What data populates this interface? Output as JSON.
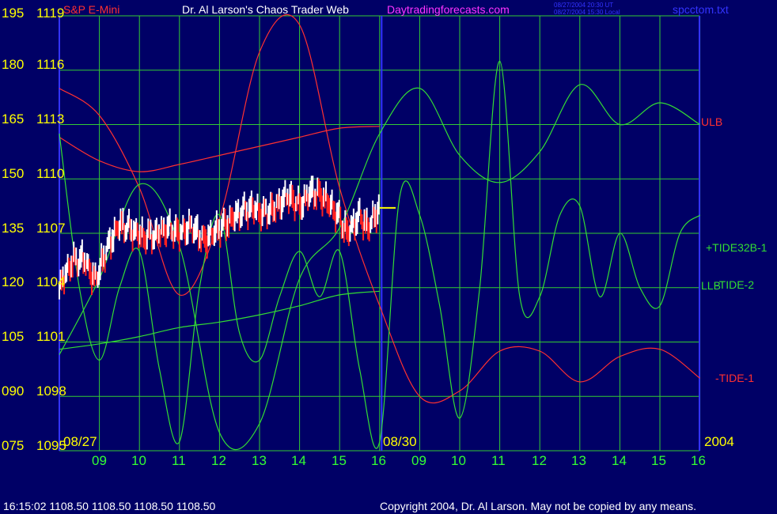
{
  "header": {
    "left": "S&P E-Mini",
    "title": "Dr. Al Larson's Chaos Trader Web",
    "site": "Daytradingforecasts.com",
    "stamp_ut": "08/27/2004 20:30 UT",
    "stamp_local": "08/27/2004 15:30 Local",
    "file": "spcctom.txt"
  },
  "footer": {
    "quote": "16:15:02  1108.50 1108.50 1108.50 1108.50",
    "copyright": "Copyright 2004, Dr. Al Larson. May not be copied by any means."
  },
  "colors": {
    "background": "#000066",
    "grid": "#33cc33",
    "price": "#ffffff",
    "down_bar": "#ff2020",
    "red_series": "#ff3030",
    "green_series": "#33dd33",
    "axis_text": "#ffff00",
    "divider": "#3333ff"
  },
  "chart_data": {
    "type": "line",
    "title": "S&P E-Mini",
    "x_ticks": [
      "09",
      "10",
      "11",
      "12",
      "13",
      "14",
      "15",
      "16",
      "09",
      "10",
      "11",
      "12",
      "13",
      "14",
      "15",
      "16"
    ],
    "date_labels": [
      "08/27",
      "08/30",
      "2004"
    ],
    "y_left_ticks": [
      "195",
      "180",
      "165",
      "150",
      "135",
      "120",
      "105",
      "090",
      "075"
    ],
    "y_price_ticks": [
      "1119",
      "1116",
      "1113",
      "1110",
      "1107",
      "1104",
      "1101",
      "1098",
      "1095"
    ],
    "ylim_price": [
      1095,
      1119
    ],
    "series_labels": [
      "ULB",
      "+TIDE32B-1",
      "LLB",
      "-TIDE-2",
      "-TIDE-1"
    ],
    "series": [
      {
        "name": "ULB",
        "color": "#ff3030",
        "x": [
          0,
          1,
          2,
          3,
          4,
          5,
          6,
          7,
          8
        ],
        "y": [
          1112.3,
          1111.0,
          1110.4,
          1110.8,
          1111.3,
          1111.8,
          1112.3,
          1112.8,
          1112.9
        ]
      },
      {
        "name": "LLB",
        "color": "#33dd33",
        "x": [
          0,
          1,
          2,
          3,
          4,
          5,
          6,
          7,
          8
        ],
        "y": [
          1100.6,
          1100.9,
          1101.3,
          1101.8,
          1102.1,
          1102.5,
          1103.0,
          1103.6,
          1103.8
        ]
      },
      {
        "name": "-TIDE-1",
        "color": "#ff3030",
        "x": [
          0,
          1,
          2,
          3,
          4,
          5,
          6,
          7,
          8,
          9,
          10,
          11,
          12,
          13,
          14,
          15,
          16
        ],
        "y": [
          1115.0,
          1113.5,
          1109.5,
          1103.6,
          1107.8,
          1117.0,
          1118.5,
          1109.5,
          1103.0,
          1098.0,
          1098.3,
          1100.5,
          1100.5,
          1098.8,
          1100.2,
          1100.6,
          1099.0
        ]
      },
      {
        "name": "-TIDE-2",
        "color": "#33dd33",
        "x": [
          0,
          1,
          2,
          3,
          4,
          5,
          6,
          7,
          8,
          9,
          10,
          11,
          12,
          13,
          14,
          15,
          16
        ],
        "y": [
          1100.3,
          1104.5,
          1109.7,
          1106.3,
          1096.0,
          1096.5,
          1104.5,
          1107.3,
          1112.5,
          1115.0,
          1111.3,
          1109.8,
          1111.5,
          1115.2,
          1113.0,
          1114.2,
          1113.0
        ]
      },
      {
        "name": "+TIDE32B-1",
        "color": "#33dd33",
        "x": [
          0,
          0.5,
          1,
          1.5,
          2,
          2.5,
          3,
          3.5,
          4,
          4.5,
          5,
          5.5,
          6,
          6.5,
          7,
          7.5,
          8,
          8.5,
          9,
          9.5,
          10,
          10.5,
          11,
          11.5,
          12,
          12.5,
          13,
          13.5,
          14,
          14.5,
          15,
          15.5,
          16
        ],
        "y": [
          1112.5,
          1104,
          1100,
          1104,
          1106,
          1099.5,
          1095.5,
          1104,
          1108,
          1101.5,
          1100,
          1103.5,
          1106,
          1103.5,
          1106,
          1099.5,
          1095.5,
          1109,
          1108,
          1103,
          1096.8,
          1104,
          1116.5,
          1103.5,
          1103.5,
          1108,
          1108.5,
          1103.5,
          1107,
          1104,
          1103,
          1107,
          1108
        ]
      }
    ],
    "price_path": {
      "x": [
        0,
        0.3,
        0.6,
        0.9,
        1.2,
        1.5,
        1.8,
        2.1,
        2.4,
        2.7,
        3.0,
        3.3,
        3.6,
        3.9,
        4.2,
        4.5,
        4.8,
        5.1,
        5.4,
        5.7,
        6.0,
        6.3,
        6.6,
        6.9,
        7.2,
        7.5,
        7.7,
        8.0
      ],
      "y": [
        1104.0,
        1105.4,
        1105.6,
        1104.4,
        1106.2,
        1107.5,
        1107.2,
        1106.8,
        1106.9,
        1107.3,
        1107.0,
        1107.4,
        1106.6,
        1107.1,
        1107.6,
        1108.1,
        1108.4,
        1108.1,
        1108.4,
        1109.1,
        1108.5,
        1109.3,
        1109.0,
        1108.2,
        1107.0,
        1108.0,
        1107.3,
        1108.4
      ]
    }
  }
}
